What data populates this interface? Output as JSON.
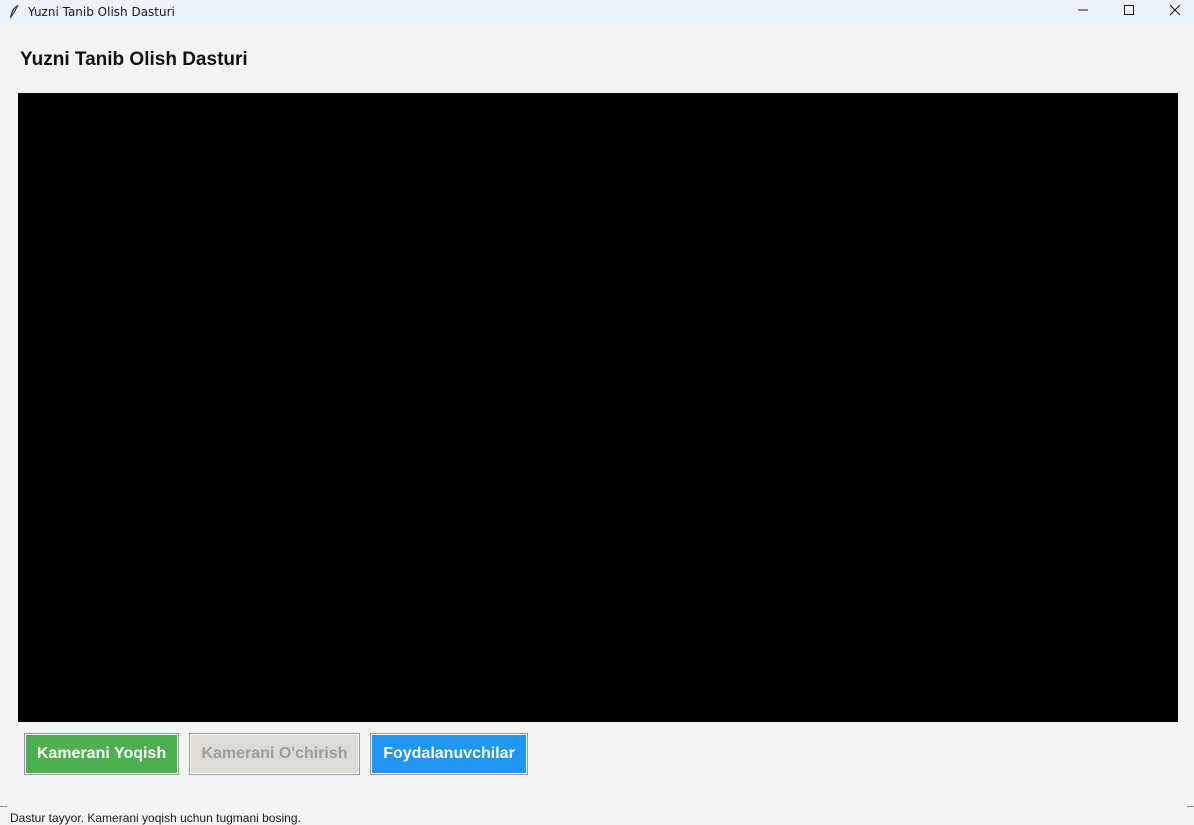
{
  "window": {
    "title": "Yuzni Tanib Olish Dasturi",
    "icon": "feather-icon",
    "controls": [
      "minimize-icon",
      "maximize-icon",
      "close-icon"
    ]
  },
  "app": {
    "title": "Yuzni Tanib Olish Dasturi"
  },
  "video": {
    "background": "#000000"
  },
  "buttons": {
    "start_label": "Kamerani Yoqish",
    "stop_label": "Kamerani O'chirish",
    "users_label": "Foydalanuvchilar"
  },
  "colors": {
    "start_button": "#4caf50",
    "stop_button_disabled": "#dddbd6",
    "users_button": "#2196f3"
  },
  "status": {
    "text": "Dastur tayyor. Kamerani yoqish uchun tugmani bosing."
  }
}
